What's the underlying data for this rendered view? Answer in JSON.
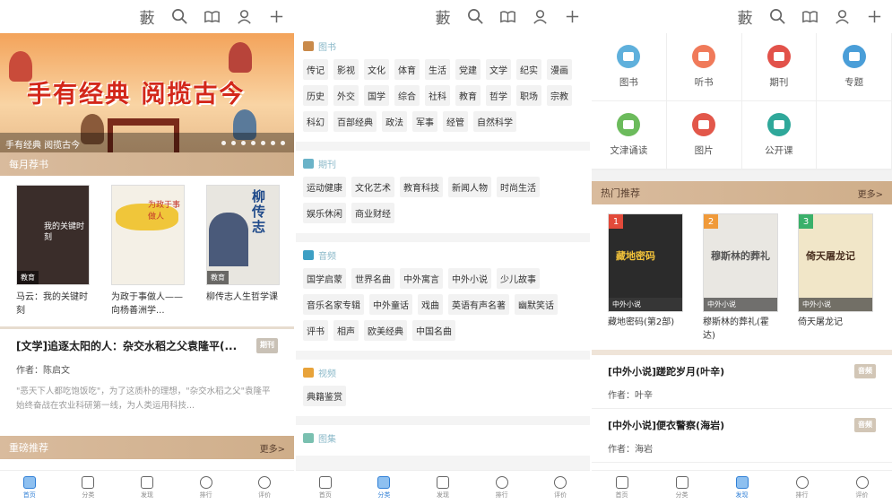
{
  "topbar": {
    "icons": [
      "bookshelf-icon",
      "search-icon",
      "reading-icon",
      "user-icon",
      "plus-icon"
    ],
    "bookshelf_glyph": "藪"
  },
  "panel1": {
    "banner": {
      "title": "手有经典 阅揽古今",
      "caption": "手有经典 阅揽古今"
    },
    "monthly": {
      "title": "每月荐书"
    },
    "books": [
      {
        "tag": "教育",
        "name": "马云：我的关键时刻",
        "cover": "#3a2d2a",
        "cover_title": "我的关键时刻"
      },
      {
        "tag": "",
        "name": "为政于事做人——向杨善洲学...",
        "cover": "#f4f0e6",
        "cover_title": "为政于事做人"
      },
      {
        "tag": "教育",
        "name": "柳传志人生哲学课",
        "cover": "#e8e6e0",
        "cover_title": "柳传志"
      }
    ],
    "article": {
      "title": "[文学]追逐太阳的人：杂交水稻之父袁隆平(...",
      "badge": "期刊",
      "author": "作者：陈启文",
      "excerpt": "\"恶天下人都吃饱饭吃\"，为了这质朴的理想，\"杂交水稻之父\"袁隆平始终奋战在农业科研第一线，为人类运用科技..."
    },
    "featured": {
      "title": "重磅推荐",
      "more": "更多>"
    }
  },
  "panel2": {
    "groups": [
      {
        "title": "图书",
        "color": "#c98a4a",
        "tags": [
          "传记",
          "影视",
          "文化",
          "体育",
          "生活",
          "党建",
          "文学",
          "纪实",
          "漫画",
          "历史",
          "外交",
          "国学",
          "综合",
          "社科",
          "教育",
          "哲学",
          "职场",
          "宗教",
          "科幻",
          "百部经典",
          "政法",
          "军事",
          "经管",
          "自然科学"
        ]
      },
      {
        "title": "期刊",
        "color": "#6ab3c8",
        "tags": [
          "运动健康",
          "文化艺术",
          "教育科技",
          "新闻人物",
          "时尚生活",
          "娱乐休闲",
          "商业财经"
        ]
      },
      {
        "title": "音频",
        "color": "#3d9fc4",
        "tags": [
          "国学启蒙",
          "世界名曲",
          "中外寓言",
          "中外小说",
          "少儿故事",
          "音乐名家专辑",
          "中外童话",
          "戏曲",
          "英语有声名著",
          "幽默笑话",
          "评书",
          "相声",
          "欧美经典",
          "中国名曲"
        ]
      },
      {
        "title": "视频",
        "color": "#e8a33a",
        "tags": [
          "典籍鉴赏"
        ]
      },
      {
        "title": "图集",
        "color": "#7ac0b0",
        "tags": []
      }
    ]
  },
  "panel3": {
    "categories": [
      {
        "label": "图书",
        "color": "#5fb0dc"
      },
      {
        "label": "听书",
        "color": "#f07a5a"
      },
      {
        "label": "期刊",
        "color": "#e2524a"
      },
      {
        "label": "专题",
        "color": "#4a9ed8"
      },
      {
        "label": "文津诵读",
        "color": "#6cbb5c"
      },
      {
        "label": "图片",
        "color": "#e2574a"
      },
      {
        "label": "公开课",
        "color": "#2fa89a"
      },
      {
        "label": "",
        "color": ""
      }
    ],
    "hot": {
      "title": "热门推荐",
      "more": "更多>"
    },
    "hot_books": [
      {
        "rank": "1",
        "rank_color": "#e24a3a",
        "tag": "中外小说",
        "name": "藏地密码(第2部)",
        "cover": "#2b2b2b",
        "cover_title": "藏地密码"
      },
      {
        "rank": "2",
        "rank_color": "#f09a3a",
        "tag": "中外小说",
        "name": "穆斯林的葬礼(霍达)",
        "cover": "#e9e7e2",
        "cover_title": "穆斯林的葬礼"
      },
      {
        "rank": "3",
        "rank_color": "#3ab06a",
        "tag": "中外小说",
        "name": "倚天屠龙记",
        "cover": "#f1e6c8",
        "cover_title": "倚天屠龙记"
      }
    ],
    "novels": [
      {
        "title": "[中外小说]蹉跎岁月(叶辛)",
        "badge": "音频",
        "author": "作者：叶辛"
      },
      {
        "title": "[中外小说]便衣警察(海岩)",
        "badge": "音频",
        "author": "作者：海岩"
      }
    ]
  },
  "bottom_nav": [
    {
      "label": "首页"
    },
    {
      "label": "分类"
    },
    {
      "label": "发现"
    },
    {
      "label": "排行"
    },
    {
      "label": "评价"
    }
  ]
}
